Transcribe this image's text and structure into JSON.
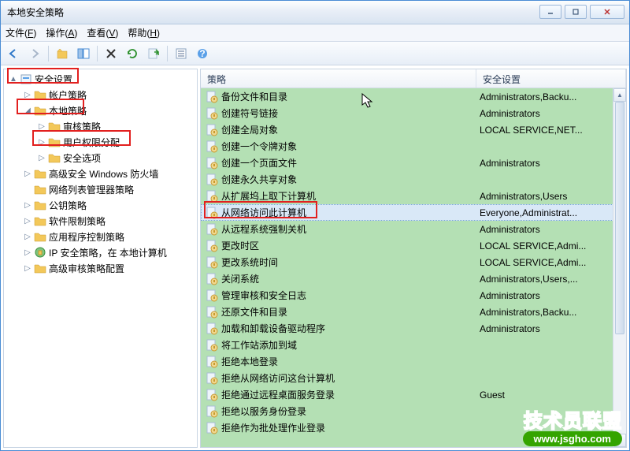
{
  "window": {
    "title": "本地安全策略"
  },
  "menubar": [
    {
      "label": "文件",
      "accel": "F"
    },
    {
      "label": "操作",
      "accel": "A"
    },
    {
      "label": "查看",
      "accel": "V"
    },
    {
      "label": "帮助",
      "accel": "H"
    }
  ],
  "toolbar_icons": [
    "back",
    "forward",
    "up",
    "show-hide",
    "delete",
    "refresh",
    "export",
    "properties",
    "help"
  ],
  "columns": {
    "policy": "策略",
    "setting": "安全设置"
  },
  "tree": [
    {
      "depth": 0,
      "toggle": "▲",
      "icon": "root",
      "label": "安全设置"
    },
    {
      "depth": 1,
      "toggle": "▷",
      "icon": "folder",
      "label": "帐户策略"
    },
    {
      "depth": 1,
      "toggle": "◢",
      "icon": "folder",
      "label": "本地策略"
    },
    {
      "depth": 2,
      "toggle": "▷",
      "icon": "folder",
      "label": "审核策略"
    },
    {
      "depth": 2,
      "toggle": "▷",
      "icon": "folder",
      "label": "用户权限分配"
    },
    {
      "depth": 2,
      "toggle": "▷",
      "icon": "folder",
      "label": "安全选项"
    },
    {
      "depth": 1,
      "toggle": "▷",
      "icon": "folder",
      "label": "高级安全 Windows 防火墙"
    },
    {
      "depth": 1,
      "toggle": "",
      "icon": "folder",
      "label": "网络列表管理器策略"
    },
    {
      "depth": 1,
      "toggle": "▷",
      "icon": "folder",
      "label": "公钥策略"
    },
    {
      "depth": 1,
      "toggle": "▷",
      "icon": "folder",
      "label": "软件限制策略"
    },
    {
      "depth": 1,
      "toggle": "▷",
      "icon": "folder",
      "label": "应用程序控制策略"
    },
    {
      "depth": 1,
      "toggle": "▷",
      "icon": "ipsec",
      "label": "IP 安全策略，在 本地计算机"
    },
    {
      "depth": 1,
      "toggle": "▷",
      "icon": "folder",
      "label": "高级审核策略配置"
    }
  ],
  "policies": [
    {
      "name": "备份文件和目录",
      "setting": "Administrators,Backu..."
    },
    {
      "name": "创建符号链接",
      "setting": "Administrators"
    },
    {
      "name": "创建全局对象",
      "setting": "LOCAL SERVICE,NET..."
    },
    {
      "name": "创建一个令牌对象",
      "setting": ""
    },
    {
      "name": "创建一个页面文件",
      "setting": "Administrators"
    },
    {
      "name": "创建永久共享对象",
      "setting": ""
    },
    {
      "name": "从扩展坞上取下计算机",
      "setting": "Administrators,Users"
    },
    {
      "name": "从网络访问此计算机",
      "setting": "Everyone,Administrat...",
      "selected": true
    },
    {
      "name": "从远程系统强制关机",
      "setting": "Administrators"
    },
    {
      "name": "更改时区",
      "setting": "LOCAL SERVICE,Admi..."
    },
    {
      "name": "更改系统时间",
      "setting": "LOCAL SERVICE,Admi..."
    },
    {
      "name": "关闭系统",
      "setting": "Administrators,Users,..."
    },
    {
      "name": "管理审核和安全日志",
      "setting": "Administrators"
    },
    {
      "name": "还原文件和目录",
      "setting": "Administrators,Backu..."
    },
    {
      "name": "加载和卸载设备驱动程序",
      "setting": "Administrators"
    },
    {
      "name": "将工作站添加到域",
      "setting": ""
    },
    {
      "name": "拒绝本地登录",
      "setting": ""
    },
    {
      "name": "拒绝从网络访问这台计算机",
      "setting": ""
    },
    {
      "name": "拒绝通过远程桌面服务登录",
      "setting": "Guest"
    },
    {
      "name": "拒绝以服务身份登录",
      "setting": ""
    },
    {
      "name": "拒绝作为批处理作业登录",
      "setting": ""
    }
  ],
  "watermark": {
    "cn": "技术员联盟",
    "url": "www.jsgho.com"
  }
}
